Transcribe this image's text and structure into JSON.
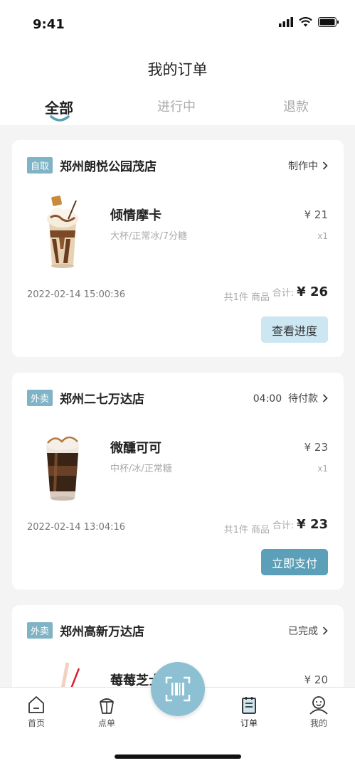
{
  "status_bar": {
    "time": "9:41"
  },
  "header": {
    "title": "我的订单"
  },
  "tabs": [
    {
      "label": "全部",
      "active": true
    },
    {
      "label": "进行中",
      "active": false
    },
    {
      "label": "退款",
      "active": false
    }
  ],
  "orders": [
    {
      "tag": "自取",
      "store": "郑州朗悦公园茂店",
      "status": "制作中",
      "product_name": "倾情摩卡",
      "product_spec": "大杯/正常冰/7分糖",
      "product_price": "¥ 21",
      "product_qty": "x1",
      "time": "2022-02-14 15:00:36",
      "count": "共1件 商品",
      "total_label": "合计:",
      "total_value": "¥ 26",
      "button": "查看进度"
    },
    {
      "tag": "外卖",
      "store": "郑州二七万达店",
      "status": "04:00  待付款",
      "product_name": "微醺可可",
      "product_spec": "中杯/冰/正常糖",
      "product_price": "¥ 23",
      "product_qty": "x1",
      "time": "2022-02-14 13:04:16",
      "count": "共1件 商品",
      "total_label": "合计:",
      "total_value": "¥ 23",
      "button": "立即支付"
    },
    {
      "tag": "外卖",
      "store": "郑州高新万达店",
      "status": "已完成",
      "product_name": "莓莓芝士",
      "product_price": "¥ 20"
    }
  ],
  "tabbar": {
    "items": [
      {
        "label": "首页",
        "icon": "home-icon"
      },
      {
        "label": "点单",
        "icon": "cup-icon"
      },
      {
        "label": "订单",
        "icon": "order-icon"
      },
      {
        "label": "我的",
        "icon": "profile-icon"
      }
    ],
    "scan_icon": "scan-icon"
  },
  "colors": {
    "accent": "#5ba0b8",
    "tag": "#7fb3c6",
    "light_button": "#cce6f2"
  }
}
